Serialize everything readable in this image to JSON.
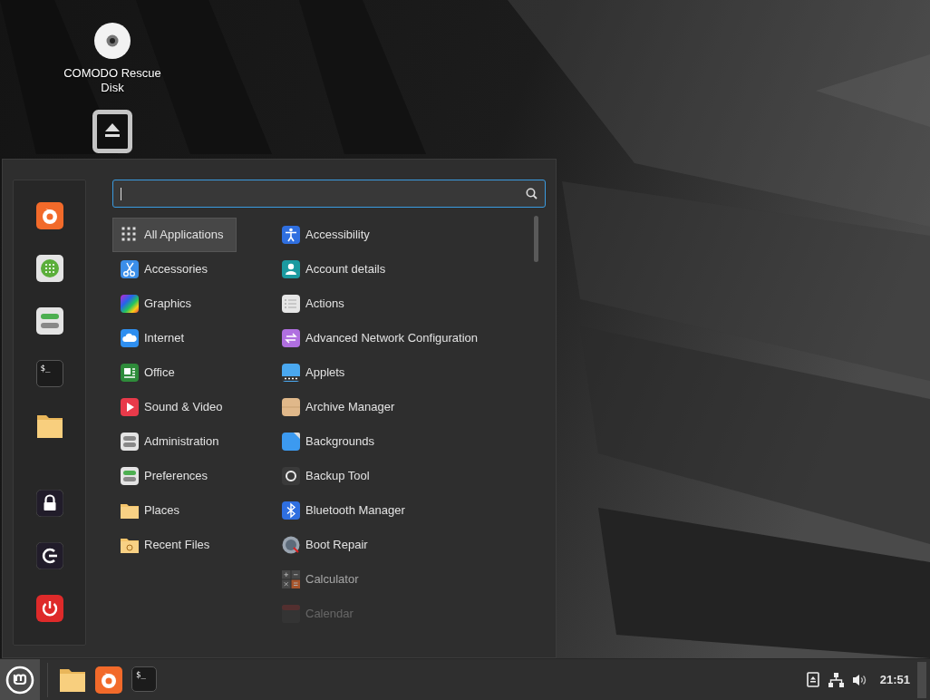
{
  "desktop_icons": [
    {
      "kind": "disc",
      "label": "COMODO Rescue Disk"
    },
    {
      "kind": "drive"
    }
  ],
  "menu": {
    "favorites": [
      {
        "kind": "browser"
      },
      {
        "kind": "software"
      },
      {
        "kind": "settings"
      },
      {
        "kind": "terminal",
        "glyph": "$_"
      },
      {
        "kind": "files"
      },
      {
        "kind": "lock"
      },
      {
        "kind": "logout"
      },
      {
        "kind": "power"
      }
    ],
    "categories": [
      {
        "label": "All Applications",
        "selected": true
      },
      {
        "label": "Accessories",
        "selected": false
      },
      {
        "label": "Graphics",
        "selected": false
      },
      {
        "label": "Internet",
        "selected": false
      },
      {
        "label": "Office",
        "selected": false
      },
      {
        "label": "Sound & Video",
        "selected": false
      },
      {
        "label": "Administration",
        "selected": false
      },
      {
        "label": "Preferences",
        "selected": false
      },
      {
        "label": "Places",
        "selected": false
      },
      {
        "label": "Recent Files",
        "selected": false
      }
    ],
    "applications": [
      {
        "label": "Accessibility"
      },
      {
        "label": "Account details"
      },
      {
        "label": "Actions"
      },
      {
        "label": "Advanced Network Configuration"
      },
      {
        "label": "Applets"
      },
      {
        "label": "Archive Manager"
      },
      {
        "label": "Backgrounds"
      },
      {
        "label": "Backup Tool"
      },
      {
        "label": "Bluetooth Manager"
      },
      {
        "label": "Boot Repair"
      },
      {
        "label": "Calculator"
      },
      {
        "label": "Calendar"
      }
    ]
  },
  "taskbar": {
    "launchers": [
      {
        "kind": "files"
      },
      {
        "kind": "browser"
      },
      {
        "kind": "terminal",
        "glyph": "$_"
      }
    ],
    "tray": [
      {
        "kind": "removable"
      },
      {
        "kind": "network"
      },
      {
        "kind": "volume"
      }
    ],
    "clock": "21:51"
  }
}
